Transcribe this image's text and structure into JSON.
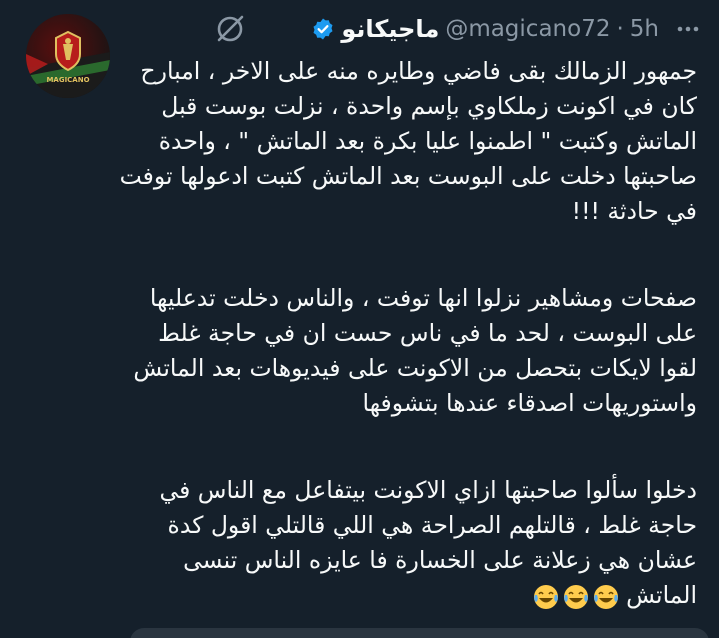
{
  "tweet": {
    "display_name": "ماجيكانو",
    "handle": "@magicano72",
    "separator": "·",
    "time": "5h",
    "verified": true,
    "avatar_text": "MAGICANO",
    "icons": {
      "verified": "verified-badge-icon",
      "grok": "grok-icon",
      "more": "more-options-icon",
      "emoji": "tears-of-joy-emoji"
    },
    "colors": {
      "background": "#15202b",
      "text": "#f7f9f9",
      "secondary": "#8b98a5",
      "verified": "#1d9bf0"
    },
    "paragraphs": [
      "جمهور الزمالك بقى فاضي وطايره منه على الاخر ، امبارح كان في اكونت زملكاوي بإسم واحدة ، نزلت بوست قبل الماتش وكتبت \" اطمنوا عليا بكرة بعد الماتش \" ، واحدة صاحبتها دخلت على البوست بعد الماتش كتبت ادعولها توفت في حادثة !!!",
      "صفحات ومشاهير نزلوا انها توفت ، والناس دخلت تدعليها على البوست ، لحد ما في ناس حست ان في حاجة غلط لقوا لايكات بتحصل من الاكونت على فيديوهات بعد الماتش واستوريهات اصدقاء عندها بتشوفها",
      "دخلوا سألوا صاحبتها ازاي الاكونت بيتفاعل مع الناس في حاجة غلط ، قالتلهم الصراحة هي اللي قالتلي اقول كدة عشان هي زعلانة على الخسارة فا عايزه الناس تنسى الماتش"
    ],
    "emoji_count": 3
  }
}
